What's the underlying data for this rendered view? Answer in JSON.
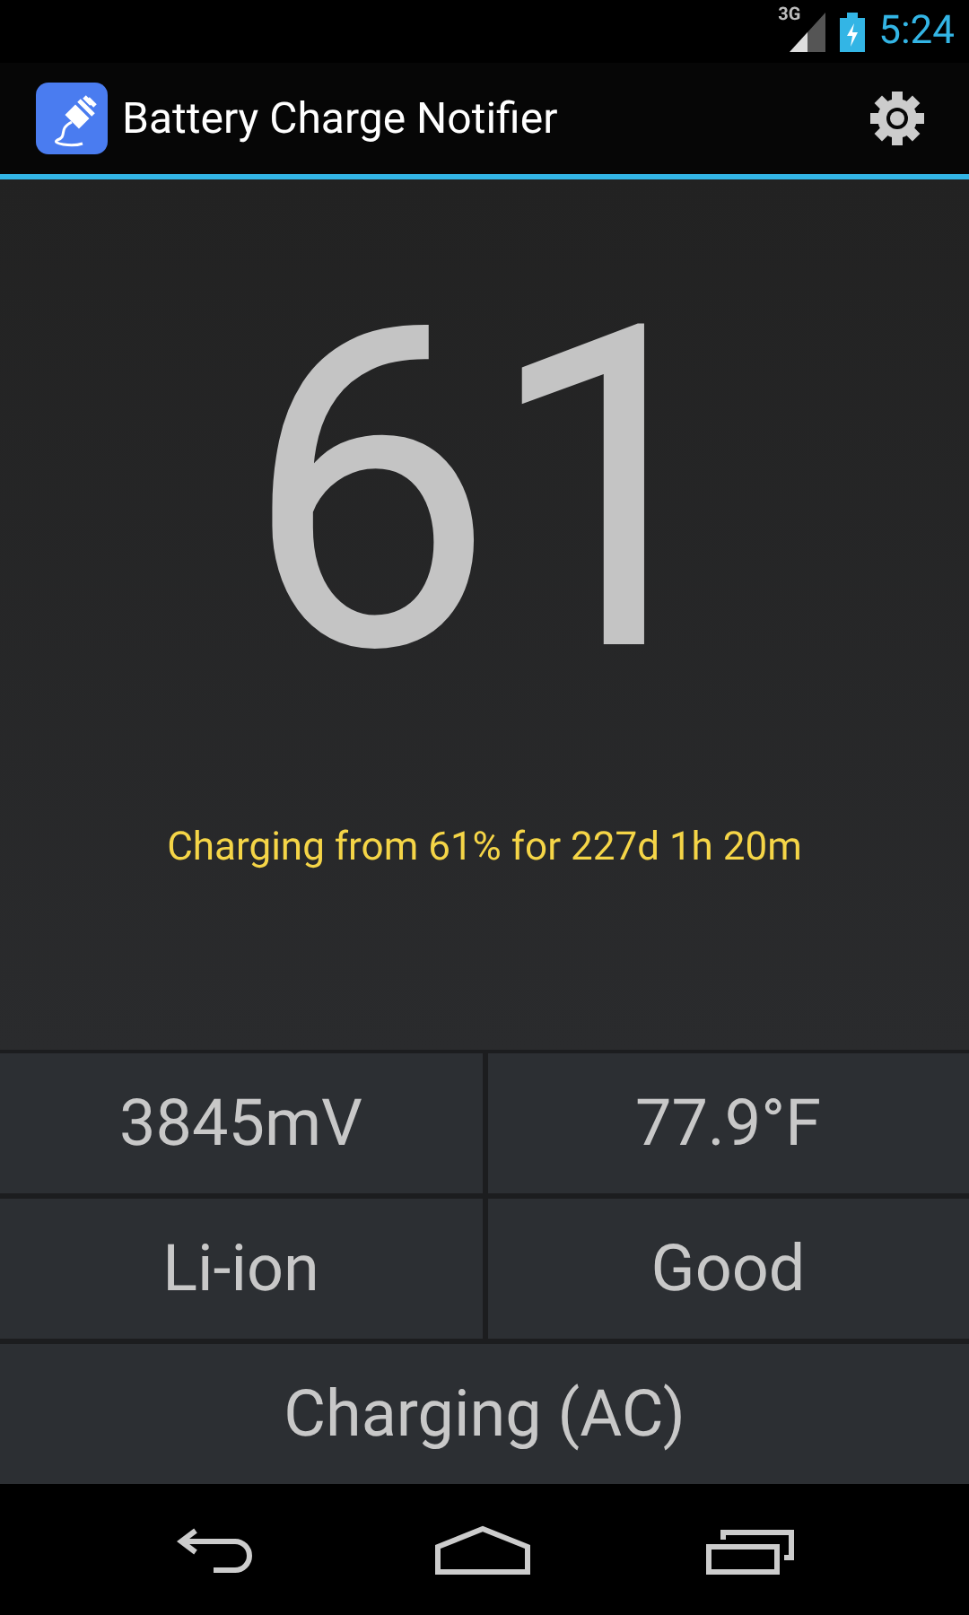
{
  "status_bar": {
    "network": "3G",
    "time": "5:24"
  },
  "action_bar": {
    "title": "Battery Charge Notifier"
  },
  "level_display": {
    "percent": "61",
    "status": "Charging from 61% for 227d 1h 20m"
  },
  "stats": [
    {
      "text": "3845mV"
    },
    {
      "text": "77.9°F"
    },
    {
      "text": "Li-ion"
    },
    {
      "text": "Good"
    }
  ],
  "charge_state": "Charging (AC)"
}
